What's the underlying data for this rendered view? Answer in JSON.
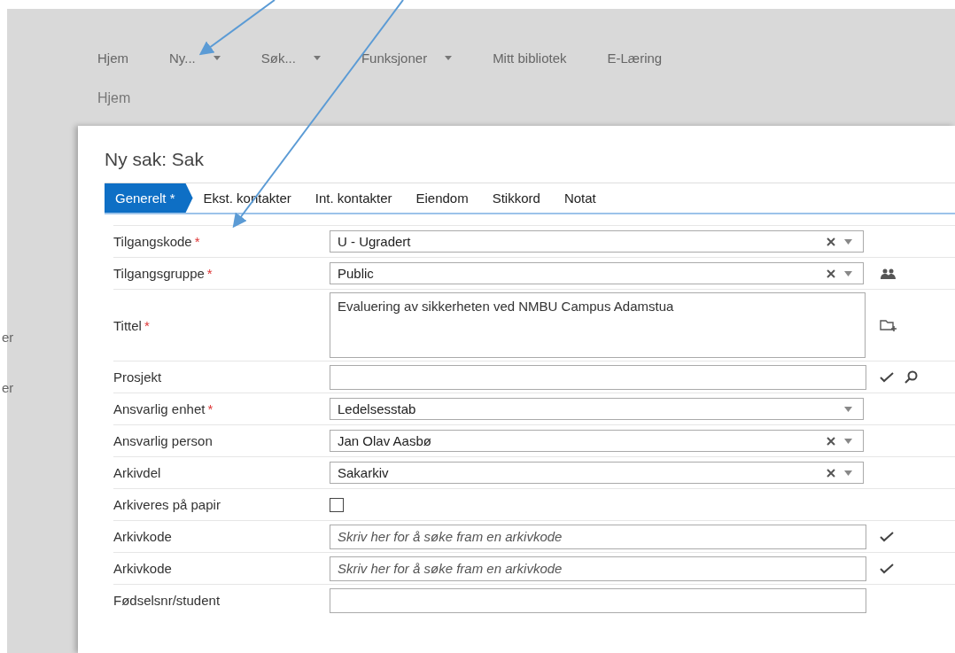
{
  "side_fragments": [
    "er",
    "er"
  ],
  "nav": [
    {
      "label": "Hjem",
      "dropdown": false
    },
    {
      "label": "Ny...",
      "dropdown": true
    },
    {
      "label": "Søk...",
      "dropdown": true
    },
    {
      "label": "Funksjoner",
      "dropdown": true
    },
    {
      "label": "Mitt bibliotek",
      "dropdown": false
    },
    {
      "label": "E-Læring",
      "dropdown": false
    }
  ],
  "breadcrumb": "Hjem",
  "dialog": {
    "title": "Ny sak: Sak",
    "tabs": [
      {
        "label": "Generelt *",
        "selected": true
      },
      {
        "label": "Ekst. kontakter",
        "selected": false
      },
      {
        "label": "Int. kontakter",
        "selected": false
      },
      {
        "label": "Eiendom",
        "selected": false
      },
      {
        "label": "Stikkord",
        "selected": false
      },
      {
        "label": "Notat",
        "selected": false
      }
    ],
    "fields": [
      {
        "label": "Tilgangskode",
        "required_mark": "*",
        "kind": "select",
        "value": "U - Ugradert",
        "clearable": true
      },
      {
        "label": "Tilgangsgruppe",
        "required_mark": "*",
        "kind": "select",
        "value": "Public",
        "clearable": true,
        "actions": [
          {
            "kind": "group"
          }
        ]
      },
      {
        "label": "Tittel",
        "required_mark": "*",
        "kind": "textarea",
        "value": "Evaluering av sikkerheten ved NMBU Campus Adamstua",
        "actions": [
          {
            "kind": "folder-add"
          }
        ]
      },
      {
        "label": "Prosjekt",
        "kind": "text",
        "actions": [
          {
            "kind": "check"
          },
          {
            "kind": "search"
          }
        ]
      },
      {
        "label": "Ansvarlig enhet",
        "required_mark": "*",
        "kind": "select",
        "value": "Ledelsesstab",
        "clearable": false
      },
      {
        "label": "Ansvarlig person",
        "kind": "select",
        "value": "Jan Olav Aasbø",
        "clearable": true
      },
      {
        "label": "Arkivdel",
        "kind": "select",
        "value": "Sakarkiv",
        "clearable": true
      },
      {
        "label": "Arkiveres på papir",
        "kind": "checkbox",
        "checked": false
      },
      {
        "label": "Arkivkode",
        "kind": "text",
        "placeholder": "Skriv her for å søke fram en arkivkode",
        "actions": [
          {
            "kind": "check"
          }
        ]
      },
      {
        "label": "Arkivkode",
        "kind": "text",
        "placeholder": "Skriv her for å søke fram en arkivkode",
        "actions": [
          {
            "kind": "check"
          }
        ]
      },
      {
        "label": "Fødselsnr/student",
        "kind": "text"
      }
    ]
  }
}
